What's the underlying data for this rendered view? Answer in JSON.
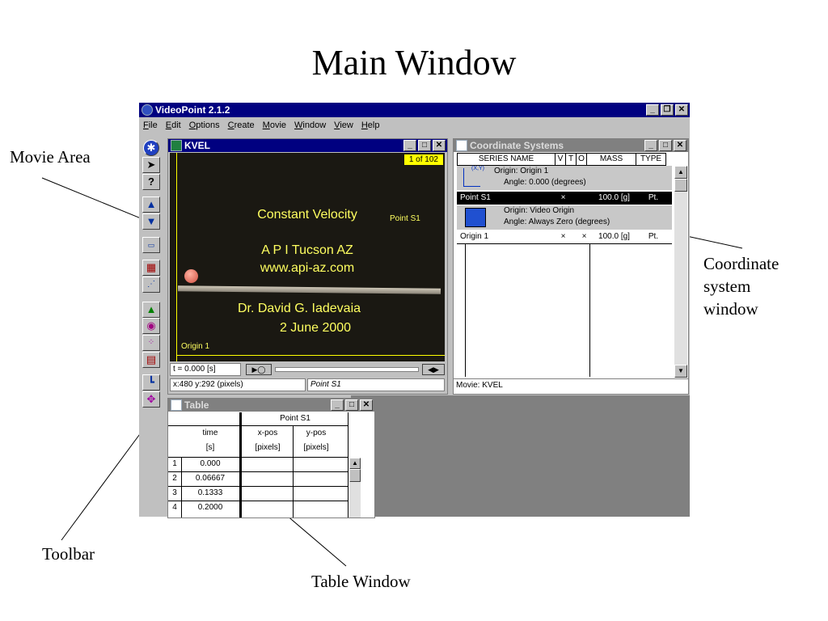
{
  "slide": {
    "title": "Main Window",
    "callouts": {
      "movie_area": "Movie Area",
      "coord_line1": "Coordinate",
      "coord_line2": "system",
      "coord_line3": "window",
      "toolbar": "Toolbar",
      "table_window": "Table Window"
    }
  },
  "app": {
    "title": "VideoPoint 2.1.2",
    "menu": [
      "File",
      "Edit",
      "Options",
      "Create",
      "Movie",
      "Window",
      "View",
      "Help"
    ]
  },
  "movie_window": {
    "title": "KVEL",
    "frame_counter": "1 of 102",
    "text_lines": [
      "Constant Velocity",
      "A P I Tucson AZ",
      "www.api-az.com",
      "Dr. David G. Iadevaia",
      "2 June 2000"
    ],
    "point_label": "Point S1",
    "origin_label": "Origin 1",
    "time": "t = 0.000 [s]",
    "coords": "x:480  y:292 (pixels)",
    "selected_series": "Point S1"
  },
  "coord_window": {
    "title": "Coordinate Systems",
    "headers": [
      "SERIES NAME",
      "V",
      "T",
      "O",
      "MASS",
      "TYPE"
    ],
    "origin1": {
      "axis_label": "(X,Y)",
      "origin": "Origin: Origin 1",
      "angle": "Angle: 0.000 (degrees)",
      "series": {
        "name": "Point S1",
        "v": "×",
        "t": "",
        "o": "",
        "mass": "100.0 [g]",
        "type": "Pt."
      }
    },
    "video_origin": {
      "origin": "Origin: Video Origin",
      "angle": "Angle: Always Zero (degrees)",
      "series": {
        "name": "Origin 1",
        "v": "×",
        "t": "",
        "o": "×",
        "mass": "100.0 [g]",
        "type": "Pt."
      }
    },
    "footer": "Movie: KVEL"
  },
  "table_window": {
    "title": "Table",
    "group_header": "Point S1",
    "col_time": "time",
    "col_time_unit": "[s]",
    "col_x": "x-pos",
    "col_x_unit": "[pixels]",
    "col_y": "y-pos",
    "col_y_unit": "[pixels]",
    "rows": [
      {
        "n": "1",
        "time": "0.000"
      },
      {
        "n": "2",
        "time": "0.06667"
      },
      {
        "n": "3",
        "time": "0.1333"
      },
      {
        "n": "4",
        "time": "0.2000"
      }
    ]
  },
  "colors": {
    "title_active": "#000080",
    "title_inactive": "#808080",
    "face": "#c0c0c0",
    "marker": "#ffff00"
  }
}
